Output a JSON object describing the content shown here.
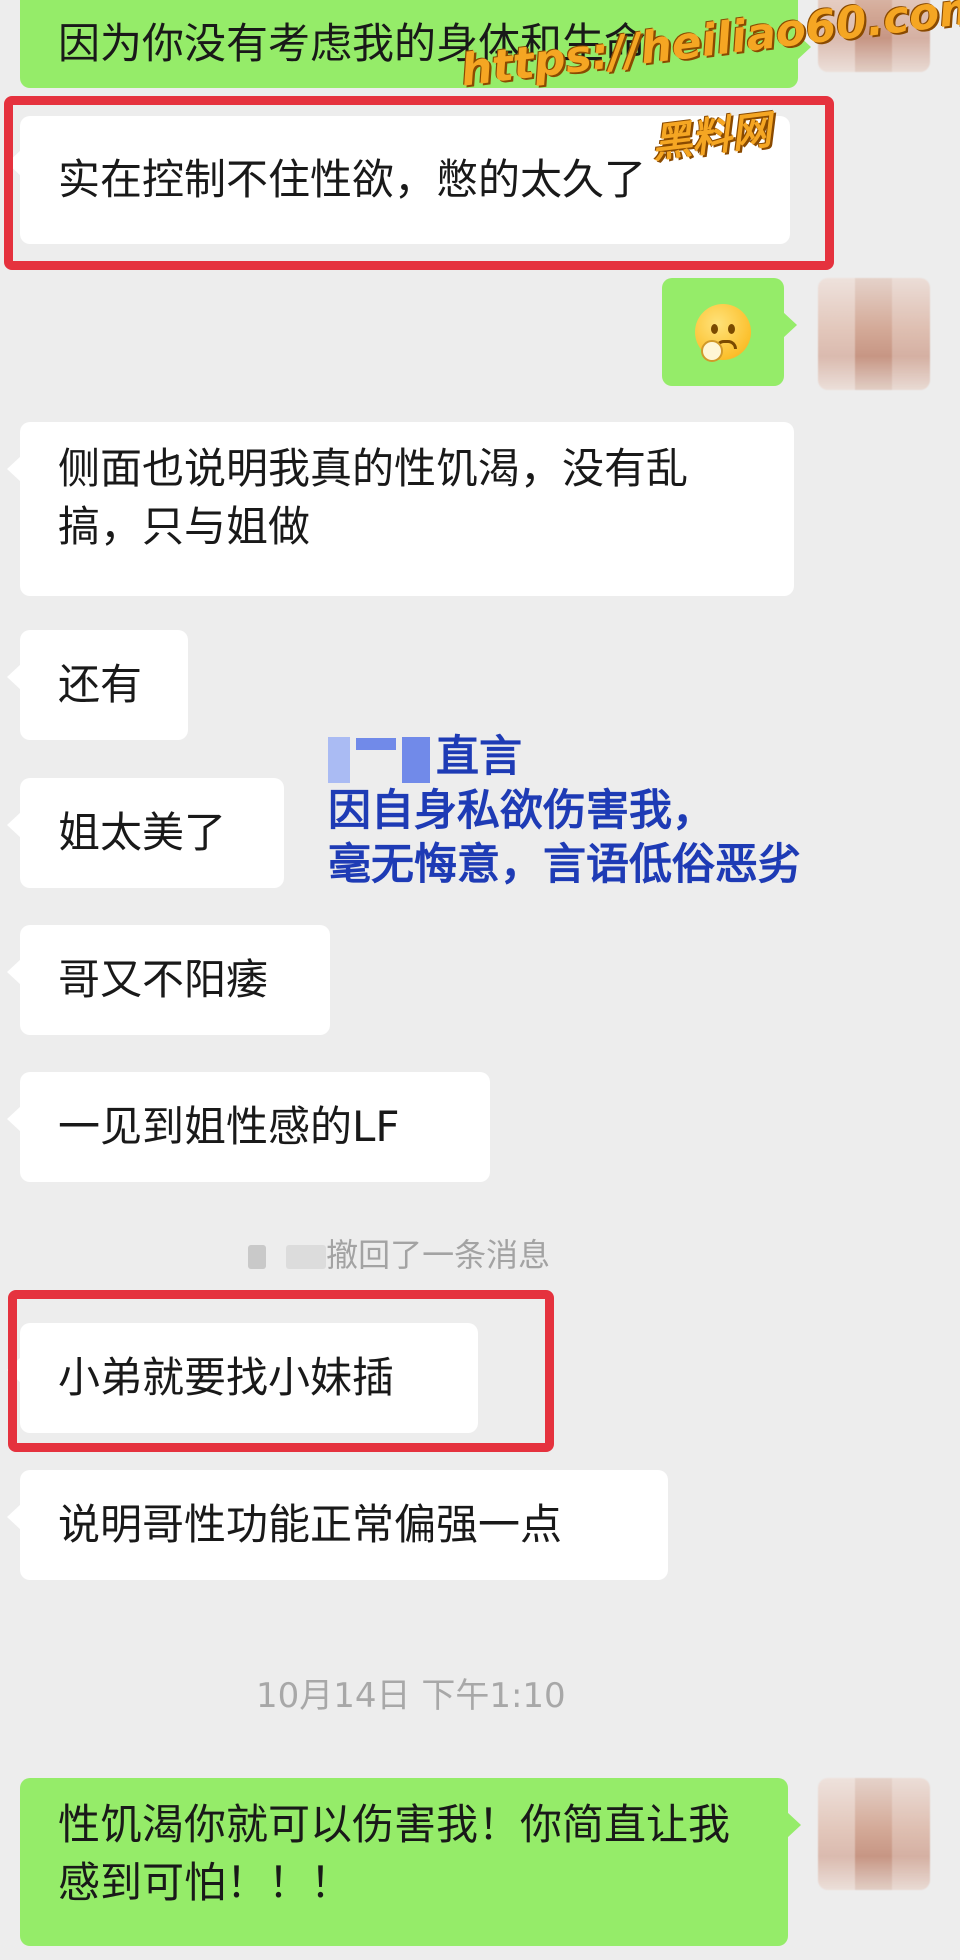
{
  "messages": {
    "m1": "因为你没有考虑我的身体和生命",
    "m2": "实在控制不住性欲，憋的太久了",
    "m4": "侧面也说明我真的性饥渴，没有乱搞，只与姐做",
    "m5": "还有",
    "m6": "姐太美了",
    "m7": "哥又不阳痿",
    "m8": "一见到姐性感的LF",
    "m9": "小弟就要找小妹插",
    "m10": "说明哥性功能正常偏强一点",
    "m11": "性饥渴你就可以伤害我！你简直让我感到可怕！！！"
  },
  "system": {
    "recall": "撤回了一条消息",
    "timestamp": "10月14日 下午1:10"
  },
  "overlay": {
    "line1": "直言",
    "line2": "因自身私欲伤害我，",
    "line3": "毫无悔意，言语低俗恶劣"
  },
  "watermark": {
    "url": "https://heiliao60.com",
    "site": "黑料网"
  },
  "colors": {
    "outgoing_bubble": "#95ec69",
    "incoming_bubble": "#ffffff",
    "highlight_border": "#e5323e",
    "overlay_text": "#1e3bb5",
    "background": "#ededed"
  },
  "icons": {
    "sticker": "shy-emoji-icon"
  }
}
